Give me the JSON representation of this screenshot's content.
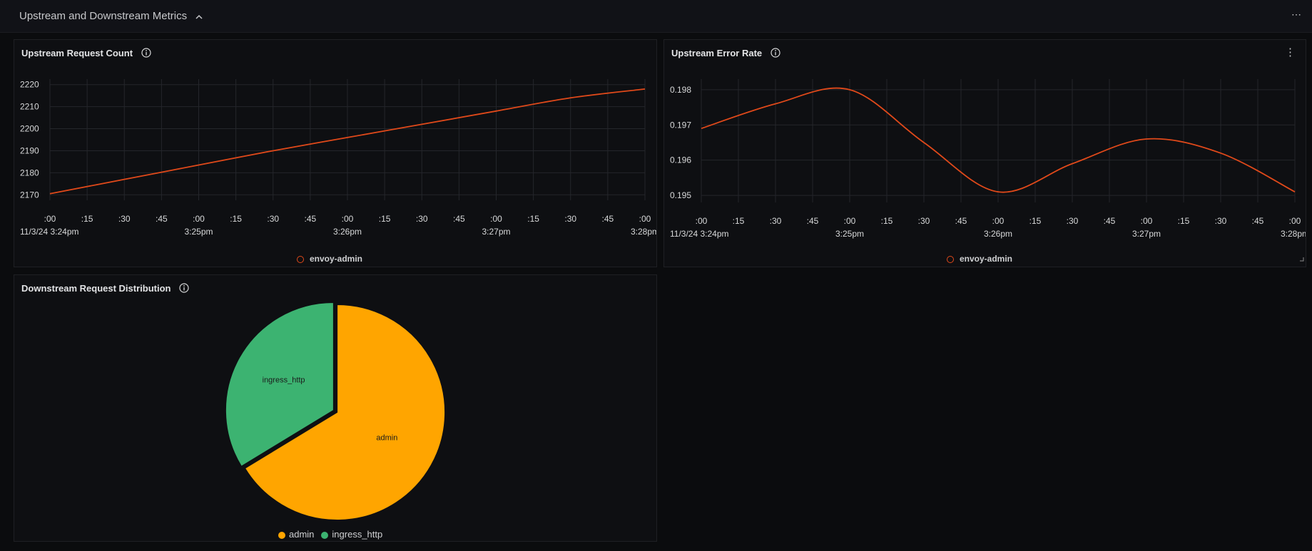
{
  "section": {
    "title": "Upstream and Downstream Metrics",
    "collapse_icon": "chevron-up-icon",
    "more_label": "⋯"
  },
  "colors": {
    "line": "#e0491a",
    "admin": "#ffa500",
    "ingress_http": "#3cb371",
    "grid": "#24262b",
    "tick_text": "#d8d9da"
  },
  "panels": {
    "upstream_count": {
      "title": "Upstream Request Count",
      "legend": "envoy-admin"
    },
    "upstream_error": {
      "title": "Upstream Error Rate",
      "legend": "envoy-admin",
      "menu_label": "⋮"
    },
    "downstream": {
      "title": "Downstream Request Distribution"
    }
  },
  "chart_data": [
    {
      "type": "line",
      "title": "Upstream Request Count",
      "x_ticks": [
        ":00",
        ":15",
        ":30",
        ":45",
        ":00",
        ":15",
        ":30",
        ":45",
        ":00",
        ":15",
        ":30",
        ":45",
        ":00",
        ":15",
        ":30",
        ":45",
        ":00"
      ],
      "x_major_labels": [
        {
          "index": 0,
          "label": "11/3/24 3:24pm"
        },
        {
          "index": 4,
          "label": "3:25pm"
        },
        {
          "index": 8,
          "label": "3:26pm"
        },
        {
          "index": 12,
          "label": "3:27pm"
        },
        {
          "index": 16,
          "label": "3:28pm"
        }
      ],
      "y_ticks": [
        "2220",
        "2210",
        "2200",
        "2190",
        "2180",
        "2170"
      ],
      "ylim": [
        2167.5,
        2222.5
      ],
      "grid": true,
      "legend_position": "bottom",
      "series": [
        {
          "name": "envoy-admin",
          "x": [
            "3:24:00pm",
            "3:24:30pm",
            "3:25:00pm",
            "3:25:30pm",
            "3:26:00pm",
            "3:26:30pm",
            "3:27:00pm",
            "3:27:30pm",
            "3:28:00pm"
          ],
          "values": [
            2170.5,
            2177,
            2183.5,
            2190,
            2196,
            2202,
            2208,
            2214,
            2218
          ]
        }
      ]
    },
    {
      "type": "line",
      "title": "Upstream Error Rate",
      "x_ticks": [
        ":00",
        ":15",
        ":30",
        ":45",
        ":00",
        ":15",
        ":30",
        ":45",
        ":00",
        ":15",
        ":30",
        ":45",
        ":00",
        ":15",
        ":30",
        ":45",
        ":00"
      ],
      "x_major_labels": [
        {
          "index": 0,
          "label": "11/3/24 3:24pm"
        },
        {
          "index": 4,
          "label": "3:25pm"
        },
        {
          "index": 8,
          "label": "3:26pm"
        },
        {
          "index": 12,
          "label": "3:27pm"
        },
        {
          "index": 16,
          "label": "3:28pm"
        }
      ],
      "y_ticks": [
        "0.198",
        "0.197",
        "0.196",
        "0.195"
      ],
      "ylim": [
        0.1948,
        0.1983
      ],
      "grid": true,
      "legend_position": "bottom",
      "series": [
        {
          "name": "envoy-admin",
          "x": [
            "3:24:00pm",
            "3:24:30pm",
            "3:25:00pm",
            "3:25:30pm",
            "3:26:00pm",
            "3:26:30pm",
            "3:27:00pm",
            "3:27:30pm",
            "3:28:00pm"
          ],
          "values": [
            0.1969,
            0.1976,
            0.198,
            0.1965,
            0.1951,
            0.1959,
            0.1966,
            0.1962,
            0.1951
          ]
        }
      ]
    },
    {
      "type": "pie",
      "title": "Downstream Request Distribution",
      "legend_position": "bottom",
      "slices": [
        {
          "label": "admin",
          "value": 66.3
        },
        {
          "label": "ingress_http",
          "value": 33.7
        }
      ]
    }
  ]
}
